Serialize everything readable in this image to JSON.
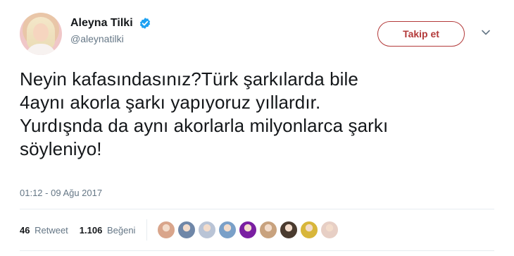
{
  "user": {
    "display_name": "Aleyna Tilki",
    "handle": "@aleynatilki",
    "verified": true
  },
  "follow_button": {
    "label": "Takip et"
  },
  "tweet": {
    "text": "Neyin kafasındasınız?Türk şarkılarda bile\n4aynı akorla şarkı yapıyoruz yıllardır.\nYurdışnda da aynı akorlarla milyonlarca şarkı\nsöyleniyo!",
    "timestamp": "01:12 - 09 Ağu 2017"
  },
  "stats": {
    "retweets": {
      "count": "46",
      "label": "Retweet"
    },
    "likes": {
      "count": "1.106",
      "label": "Beğeni"
    }
  },
  "liker_avatars": [
    "#d9a58b",
    "#6f87a8",
    "#b9c4d6",
    "#7aa0c8",
    "#7a1fa2",
    "#c8a27e",
    "#4a3b2f",
    "#d8b63a",
    "#e7cfc5"
  ],
  "colors": {
    "follow_accent": "#b33a3a",
    "verified_blue": "#1da1f2",
    "secondary_text": "#657786"
  },
  "icons": {
    "verified": "verified-badge-icon",
    "more": "chevron-down-icon"
  }
}
